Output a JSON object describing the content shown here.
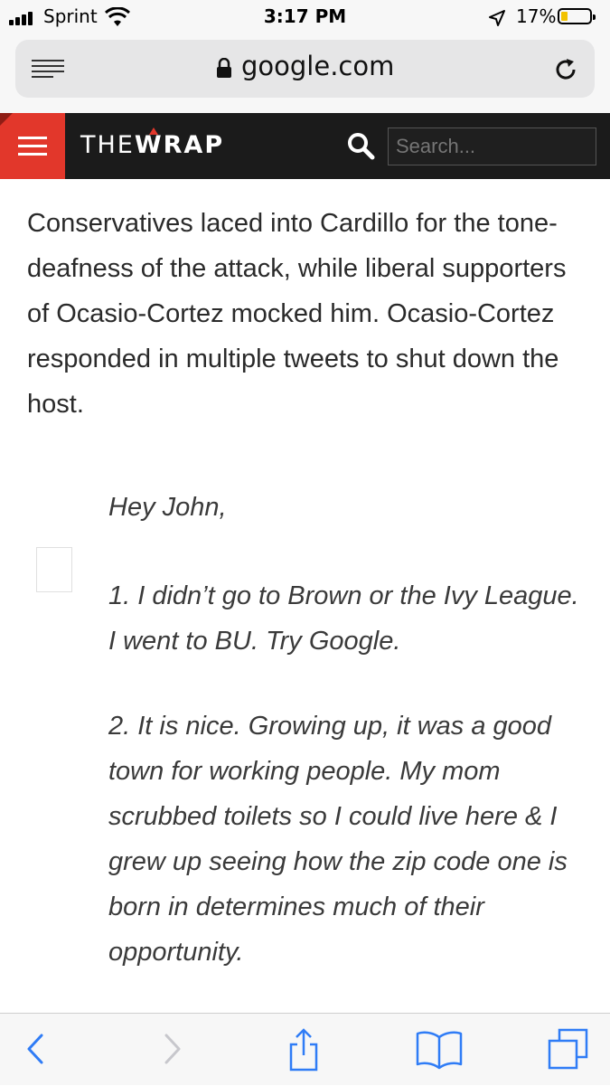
{
  "status_bar": {
    "carrier": "Sprint",
    "time": "3:17 PM",
    "battery_percent": "17%",
    "battery_level": 0.17,
    "icons": [
      "signal-icon",
      "wifi-icon",
      "location-arrow-icon",
      "battery-icon"
    ]
  },
  "browser": {
    "url": "google.com",
    "icons": [
      "reader-icon",
      "lock-icon",
      "reload-icon"
    ]
  },
  "site_header": {
    "logo_the": "THE",
    "logo_wrap": "WRAP",
    "search_placeholder": "Search...",
    "accent_color": "#e2372b",
    "header_color": "#1b1b1b"
  },
  "article": {
    "paragraph": "Conservatives laced into Cardillo for the tone-deafness of the attack, while liberal supporters of Ocasio-Cortez mocked him. Ocasio-Cortez responded in multiple tweets to shut down the host.",
    "quote": {
      "greeting": "Hey John,",
      "point1": "1. I didn’t go to Brown or the Ivy League. I went to BU. Try Google.",
      "point2": "2. It is nice. Growing up, it was a good town for working people. My mom scrubbed toilets so I could live here & I grew up seeing how the zip code one is born in determines much of their opportunity."
    }
  },
  "toolbar": {
    "icons": [
      "back-icon",
      "forward-icon",
      "share-icon",
      "bookmarks-icon",
      "tabs-icon"
    ],
    "tint_color": "#2f7cf6"
  }
}
